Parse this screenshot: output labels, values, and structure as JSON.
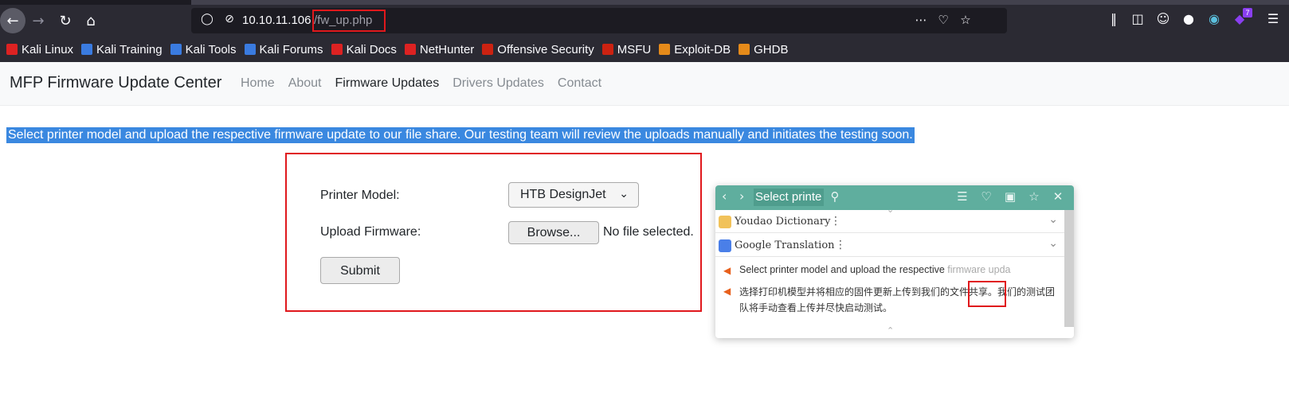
{
  "browser": {
    "url_host": "10.10.11.106",
    "url_path": "/fw_up.php",
    "extension_badge": "7",
    "bookmarks": [
      {
        "label": "Kali Linux",
        "icon": "kali-dragon-icon",
        "color": "#d22"
      },
      {
        "label": "Kali Training",
        "icon": "kali-training-icon",
        "color": "#3a7be0"
      },
      {
        "label": "Kali Tools",
        "icon": "kali-tools-icon",
        "color": "#3a7be0"
      },
      {
        "label": "Kali Forums",
        "icon": "kali-forums-icon",
        "color": "#3a7be0"
      },
      {
        "label": "Kali Docs",
        "icon": "kali-docs-icon",
        "color": "#d22"
      },
      {
        "label": "NetHunter",
        "icon": "nethunter-icon",
        "color": "#d22"
      },
      {
        "label": "Offensive Security",
        "icon": "offsec-icon",
        "color": "#c21"
      },
      {
        "label": "MSFU",
        "icon": "msfu-icon",
        "color": "#c21"
      },
      {
        "label": "Exploit-DB",
        "icon": "exploitdb-icon",
        "color": "#e58a1a"
      },
      {
        "label": "GHDB",
        "icon": "ghdb-icon",
        "color": "#e58a1a"
      }
    ]
  },
  "site": {
    "brand": "MFP Firmware Update Center",
    "nav": [
      {
        "label": "Home",
        "active": false
      },
      {
        "label": "About",
        "active": false
      },
      {
        "label": "Firmware Updates",
        "active": true
      },
      {
        "label": "Drivers Updates",
        "active": false
      },
      {
        "label": "Contact",
        "active": false
      }
    ],
    "intro": "Select printer model and upload the respective firmware update to our file share. Our testing team will review the uploads manually and initiates the testing soon. "
  },
  "form": {
    "printer_label": "Printer Model:",
    "printer_value": "HTB DesignJet",
    "upload_label": "Upload Firmware:",
    "browse_label": "Browse...",
    "no_file": "No file selected.",
    "submit_label": "Submit"
  },
  "translator": {
    "search_text": "Select printe",
    "dict1": "Youdao Dictionary",
    "dict2": "Google Translation",
    "source_main": "Select printer model and upload the respective ",
    "source_fade": "firmware upda",
    "target": "选择打印机模型并将相应的固件更新上传到我们的文件共享。我们的测试团队将手动查看上传并尽快启动测试。",
    "header_color": "#5fae9e"
  }
}
